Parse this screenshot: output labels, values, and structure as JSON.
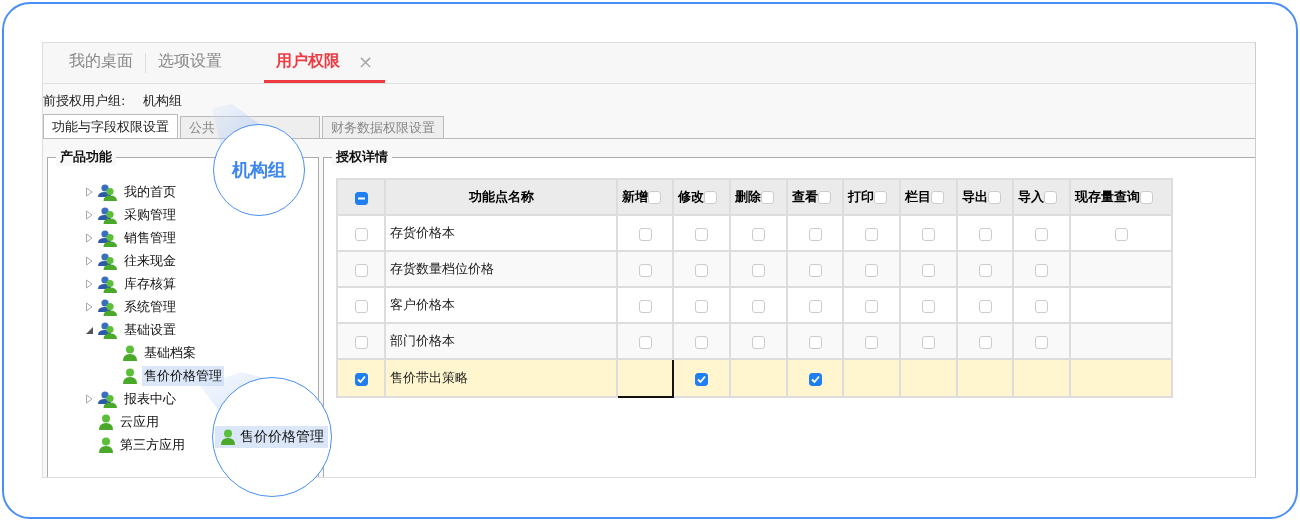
{
  "tabs": [
    {
      "label": "我的桌面",
      "selected": false,
      "closable": false
    },
    {
      "label": "选项设置",
      "selected": false,
      "closable": false
    },
    {
      "label": "用户权限",
      "selected": true,
      "closable": true,
      "close": "×"
    }
  ],
  "auth_group": {
    "label": "前授权用户组:",
    "value": "机构组"
  },
  "sub_tabs": [
    {
      "label": "功能与字段权限设置",
      "selected": true
    },
    {
      "label": "公共",
      "selected": false
    },
    {
      "label": "财务数据权限设置",
      "selected": false
    }
  ],
  "tree": {
    "title": "产品功能",
    "items": [
      {
        "label": "我的首页",
        "kind": "group",
        "expanded": false,
        "selected": false
      },
      {
        "label": "采购管理",
        "kind": "group",
        "expanded": false,
        "selected": false
      },
      {
        "label": "销售管理",
        "kind": "group",
        "expanded": false,
        "selected": false
      },
      {
        "label": "往来现金",
        "kind": "group",
        "expanded": false,
        "selected": false
      },
      {
        "label": "库存核算",
        "kind": "group",
        "expanded": false,
        "selected": false
      },
      {
        "label": "系统管理",
        "kind": "group",
        "expanded": false,
        "selected": false
      },
      {
        "label": "基础设置",
        "kind": "group",
        "expanded": true,
        "selected": false,
        "children": [
          {
            "label": "基础档案",
            "kind": "user",
            "selected": false
          },
          {
            "label": "售价价格管理",
            "kind": "user",
            "selected": true
          }
        ]
      },
      {
        "label": "报表中心",
        "kind": "group",
        "expanded": false,
        "selected": false
      },
      {
        "label": "云应用",
        "kind": "user",
        "selected": false
      },
      {
        "label": "第三方应用",
        "kind": "user",
        "selected": false
      }
    ]
  },
  "details": {
    "title": "授权详情",
    "table": {
      "select_all": {
        "indeterminate": true
      },
      "columns": [
        {
          "label": "功能点名称"
        },
        {
          "label": "新增",
          "checked": false
        },
        {
          "label": "修改",
          "checked": false
        },
        {
          "label": "删除",
          "checked": false
        },
        {
          "label": "查看",
          "checked": false
        },
        {
          "label": "打印",
          "checked": false
        },
        {
          "label": "栏目",
          "checked": false
        },
        {
          "label": "导出",
          "checked": false
        },
        {
          "label": "导入",
          "checked": false
        },
        {
          "label": "现存量查询",
          "checked": false
        }
      ],
      "rows": [
        {
          "name": "存货价格本",
          "checked": false,
          "selected": false,
          "cells": [
            {
              "kind": "checkbox",
              "checked": false
            },
            {
              "kind": "checkbox",
              "checked": false
            },
            {
              "kind": "checkbox",
              "checked": false
            },
            {
              "kind": "checkbox",
              "checked": false
            },
            {
              "kind": "checkbox",
              "checked": false
            },
            {
              "kind": "checkbox",
              "checked": false
            },
            {
              "kind": "checkbox",
              "checked": false
            },
            {
              "kind": "checkbox",
              "checked": false
            },
            {
              "kind": "checkbox",
              "checked": false
            }
          ]
        },
        {
          "name": "存货数量档位价格",
          "checked": false,
          "selected": false,
          "cells": [
            {
              "kind": "checkbox",
              "checked": false
            },
            {
              "kind": "checkbox",
              "checked": false
            },
            {
              "kind": "checkbox",
              "checked": false
            },
            {
              "kind": "checkbox",
              "checked": false
            },
            {
              "kind": "checkbox",
              "checked": false
            },
            {
              "kind": "checkbox",
              "checked": false
            },
            {
              "kind": "checkbox",
              "checked": false
            },
            {
              "kind": "checkbox",
              "checked": false
            },
            {
              "kind": "empty",
              "focused": false
            }
          ]
        },
        {
          "name": "客户价格本",
          "checked": false,
          "selected": false,
          "cells": [
            {
              "kind": "checkbox",
              "checked": false
            },
            {
              "kind": "checkbox",
              "checked": false
            },
            {
              "kind": "checkbox",
              "checked": false
            },
            {
              "kind": "checkbox",
              "checked": false
            },
            {
              "kind": "checkbox",
              "checked": false
            },
            {
              "kind": "checkbox",
              "checked": false
            },
            {
              "kind": "checkbox",
              "checked": false
            },
            {
              "kind": "checkbox",
              "checked": false
            },
            {
              "kind": "empty",
              "focused": false
            }
          ]
        },
        {
          "name": "部门价格本",
          "checked": false,
          "selected": false,
          "cells": [
            {
              "kind": "checkbox",
              "checked": false
            },
            {
              "kind": "checkbox",
              "checked": false
            },
            {
              "kind": "checkbox",
              "checked": false
            },
            {
              "kind": "checkbox",
              "checked": false
            },
            {
              "kind": "checkbox",
              "checked": false
            },
            {
              "kind": "checkbox",
              "checked": false
            },
            {
              "kind": "checkbox",
              "checked": false
            },
            {
              "kind": "checkbox",
              "checked": false
            },
            {
              "kind": "empty",
              "focused": false
            }
          ]
        },
        {
          "name": "售价带出策略",
          "checked": true,
          "selected": true,
          "cells": [
            {
              "kind": "empty",
              "focused": true
            },
            {
              "kind": "checkbox",
              "checked": true
            },
            {
              "kind": "empty",
              "focused": false
            },
            {
              "kind": "checkbox",
              "checked": true
            },
            {
              "kind": "empty",
              "focused": false
            },
            {
              "kind": "empty",
              "focused": false
            },
            {
              "kind": "empty",
              "focused": false
            },
            {
              "kind": "empty",
              "focused": false
            },
            {
              "kind": "empty",
              "focused": false
            }
          ]
        }
      ]
    }
  },
  "callouts": [
    {
      "kind": "text",
      "text": "机构组"
    },
    {
      "kind": "item",
      "label": "售价价格管理",
      "selected": true
    }
  ]
}
